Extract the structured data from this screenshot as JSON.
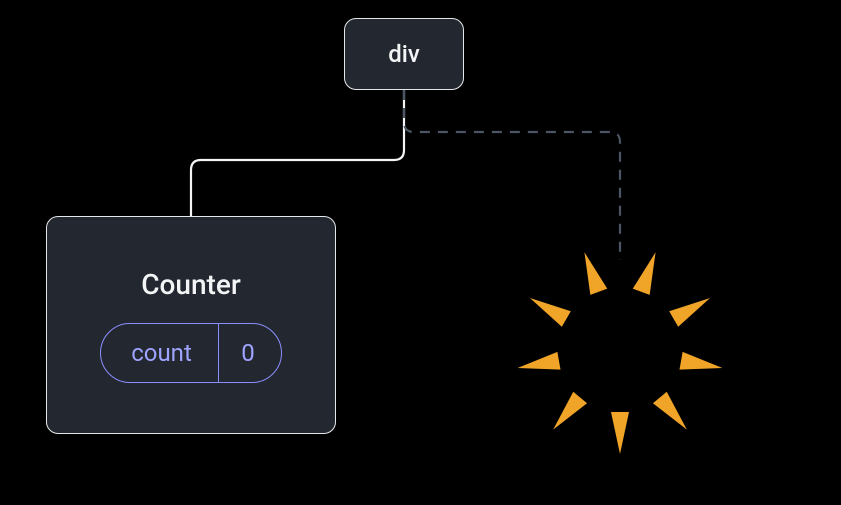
{
  "diagram": {
    "root_node_label": "div",
    "counter_node": {
      "title": "Counter",
      "state_name": "count",
      "state_value": "0"
    }
  },
  "colors": {
    "node_bg": "#23272f",
    "node_border": "#e5e7eb",
    "text": "#f3f4f6",
    "accent": "#8a8fff",
    "burst": "#f0a528",
    "connector_dash": "#4b5563"
  }
}
